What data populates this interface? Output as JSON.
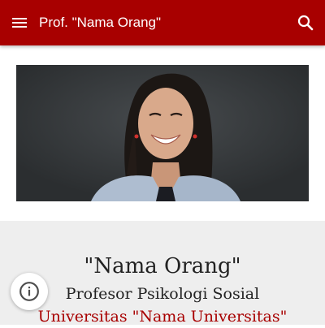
{
  "appbar": {
    "title": "Prof. \"Nama Orang\"",
    "menu_icon": "menu-icon",
    "search_icon": "search-icon",
    "background_color": "#a80000"
  },
  "hero": {
    "image": "portrait-photo"
  },
  "profile": {
    "name": "\"Nama Orang\"",
    "role": "Profesor Psikologi Sosial",
    "affiliation": "Universitas \"Nama Universitas\"",
    "affiliation_color": "#a80000"
  },
  "info_button": {
    "icon": "info-icon"
  }
}
